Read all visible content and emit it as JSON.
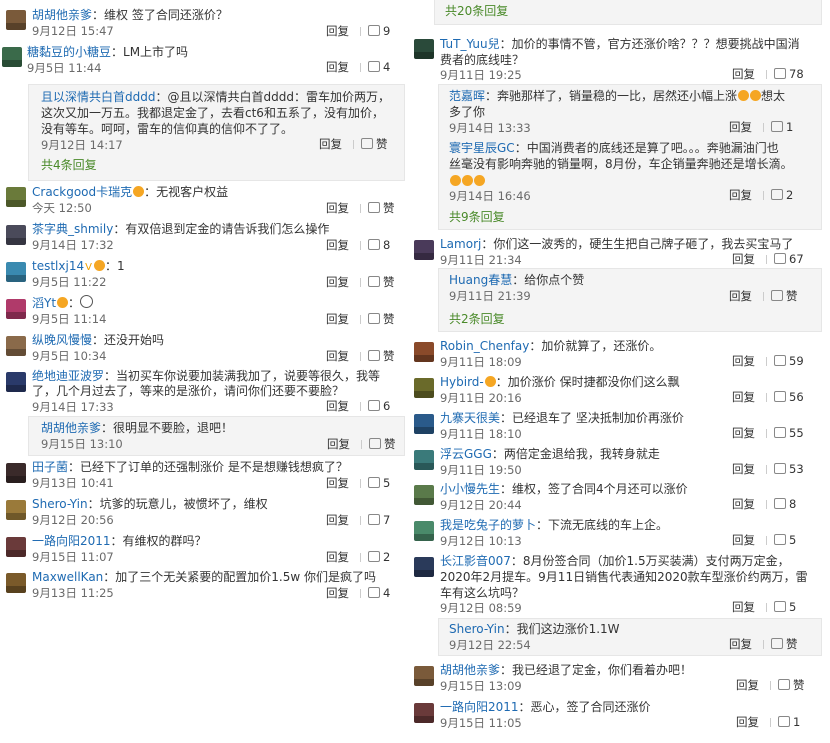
{
  "left": {
    "comments": [
      {
        "name": "胡胡他亲爹",
        "text": "：维权 签了合同还涨价？",
        "time": "9月12日 15:47",
        "reply": "回复",
        "likes": "9"
      },
      {
        "name": "糖黏豆的小糖豆",
        "text": "：LM上市了吗",
        "time": "9月5日 11:44",
        "reply": "回复",
        "likes": "4"
      },
      {
        "name": "Crackgood卡瑞克",
        "text": "：无视客户权益",
        "time": "今天 12:50",
        "reply": "回复",
        "likes": "赞"
      },
      {
        "name": "茶字典_shmily",
        "text": "：有双倍退到定金的请告诉我们怎么操作",
        "time": "9月14日 17:32",
        "reply": "回复",
        "likes": "8"
      },
      {
        "name": "testlxj14",
        "text": "：1",
        "time": "9月5日 11:22",
        "reply": "回复",
        "likes": "赞"
      },
      {
        "name": "滔Yt",
        "text": "：",
        "time": "9月5日 11:14",
        "reply": "回复",
        "likes": "赞"
      },
      {
        "name": "纵晚风慢慢",
        "text": "：还没开始吗",
        "time": "9月5日 10:34",
        "reply": "回复",
        "likes": "赞"
      },
      {
        "name": "绝地迪亚波罗",
        "text": "：当初买车你说要加装满我加了，说要等很久，我等",
        "text2": "了，几个月过去了，等来的是涨价，请问你们还要不要脸？",
        "time": "9月14日 17:33",
        "reply": "回复",
        "likes": "6"
      },
      {
        "name": "田子菌",
        "text": "：已经下了订单的还强制涨价 是不是想赚钱想疯了？",
        "time": "9月13日 10:41",
        "reply": "回复",
        "likes": "5"
      },
      {
        "name": "Shero-Yin",
        "text": "：坑爹的玩意儿，被惯坏了，维权",
        "time": "9月12日 20:56",
        "reply": "回复",
        "likes": "7"
      },
      {
        "name": "一路向阳2011",
        "text": "：有维权的群吗？",
        "time": "9月15日 11:07",
        "reply": "回复",
        "likes": "2"
      },
      {
        "name": "MaxwellKan",
        "text": "：加了三个无关紧要的配置加价1.5w 你们是疯了吗",
        "time": "9月13日 11:25",
        "reply": "回复",
        "likes": "4"
      }
    ],
    "reply_a": {
      "name": "且以深情共白首dddd",
      "text": "：@且以深情共白首dddd：雷车加价两万，",
      "text2": "这次又加一万五。我都退定金了，去看ct6和五系了，没有加价，",
      "text3": "没有等车。呵呵，雷车的信仰真的信仰不了了。",
      "time": "9月12日 14:17",
      "reply": "回复",
      "likes": "赞",
      "more": "共4条回复"
    },
    "reply_b": {
      "name": "胡胡他亲爹",
      "text": "：很明显不要脸，退吧！",
      "time": "9月15日 13:10",
      "reply": "回复",
      "likes": "赞"
    }
  },
  "right": {
    "top_more": "共20条回复",
    "comments": [
      {
        "name": "TuT_Yuu兒",
        "text": "：加价的事情不管，官方还涨价啥？？？想要挑战中国消",
        "text2": "费者的底线哇？",
        "time": "9月11日 19:25",
        "reply": "回复",
        "likes": "78"
      },
      {
        "name": "Lamorj",
        "text": "：你们这一波秀的，硬生生把自己牌子砸了，我去买宝马了",
        "time": "9月11日 21:34",
        "reply": "回复",
        "likes": "67"
      },
      {
        "name": "Robin_Chenfay",
        "text": "：加价就算了，还涨价。",
        "time": "9月11日 18:09",
        "reply": "回复",
        "likes": "59"
      },
      {
        "name": "Hybird-",
        "text": "：加价涨价 保时捷都没你们这么飘",
        "time": "9月11日 20:16",
        "reply": "回复",
        "likes": "56"
      },
      {
        "name": "九寨天很美",
        "text": "：已经退车了 坚决抵制加价再涨价",
        "time": "9月11日 18:10",
        "reply": "回复",
        "likes": "55"
      },
      {
        "name": "浮云GGG",
        "text": "：两倍定金退给我，我转身就走",
        "time": "9月11日 19:50",
        "reply": "回复",
        "likes": "53"
      },
      {
        "name": "小小慢先生",
        "text": "：维权，签了合同4个月还可以涨价",
        "time": "9月12日 20:44",
        "reply": "回复",
        "likes": "8"
      },
      {
        "name": "我是吃兔子的萝卜",
        "text": "：下流无底线的车上企。",
        "time": "9月12日 10:13",
        "reply": "回复",
        "likes": "5"
      },
      {
        "name": "长江影音007",
        "text": "：8月份签合同（加价1.5万买装满）支付两万定金，",
        "text2": "2020年2月提车。9月11日销售代表通知2020款车型涨价约两万，雷",
        "text3": "车有这么坑吗？",
        "time": "9月12日 08:59",
        "reply": "回复",
        "likes": "5"
      },
      {
        "name": "胡胡他亲爹",
        "text": "：我已经退了定金，你们看着办吧！",
        "time": "9月15日 13:09",
        "reply": "回复",
        "likes": "赞"
      },
      {
        "name": "一路向阳2011",
        "text": "：恶心，签了合同还涨价",
        "time": "9月15日 11:05",
        "reply": "回复",
        "likes": "1"
      }
    ],
    "sub_tut": [
      {
        "name": "范嘉晖",
        "text": "：奔驰那样了，销量稳的一比，居然还小幅上涨",
        "text2": "多了你",
        "time": "9月14日 13:33",
        "reply": "回复",
        "likes": "1"
      },
      {
        "name": "寰宇星辰GC",
        "text": "：中国消费者的底线还是算了吧。。。奔驰漏油门也",
        "text2": "丝毫没有影响奔驰的销量啊，8月份，车企销量奔驰还是增长滴。",
        "time": "9月14日 16:46",
        "reply": "回复",
        "likes": "2"
      }
    ],
    "sub_tut_more": "共9条回复",
    "sub_tut_suffix": "想太",
    "sub_lam": {
      "name": "Huang春慧",
      "text": "：给你点个赞",
      "time": "9月11日 21:39",
      "reply": "回复",
      "likes": "赞",
      "more": "共2条回复"
    },
    "sub_cj": {
      "name": "Shero-Yin",
      "text": "：我们这边涨价1.1W",
      "time": "9月12日 22:54",
      "reply": "回复",
      "likes": "赞"
    }
  }
}
